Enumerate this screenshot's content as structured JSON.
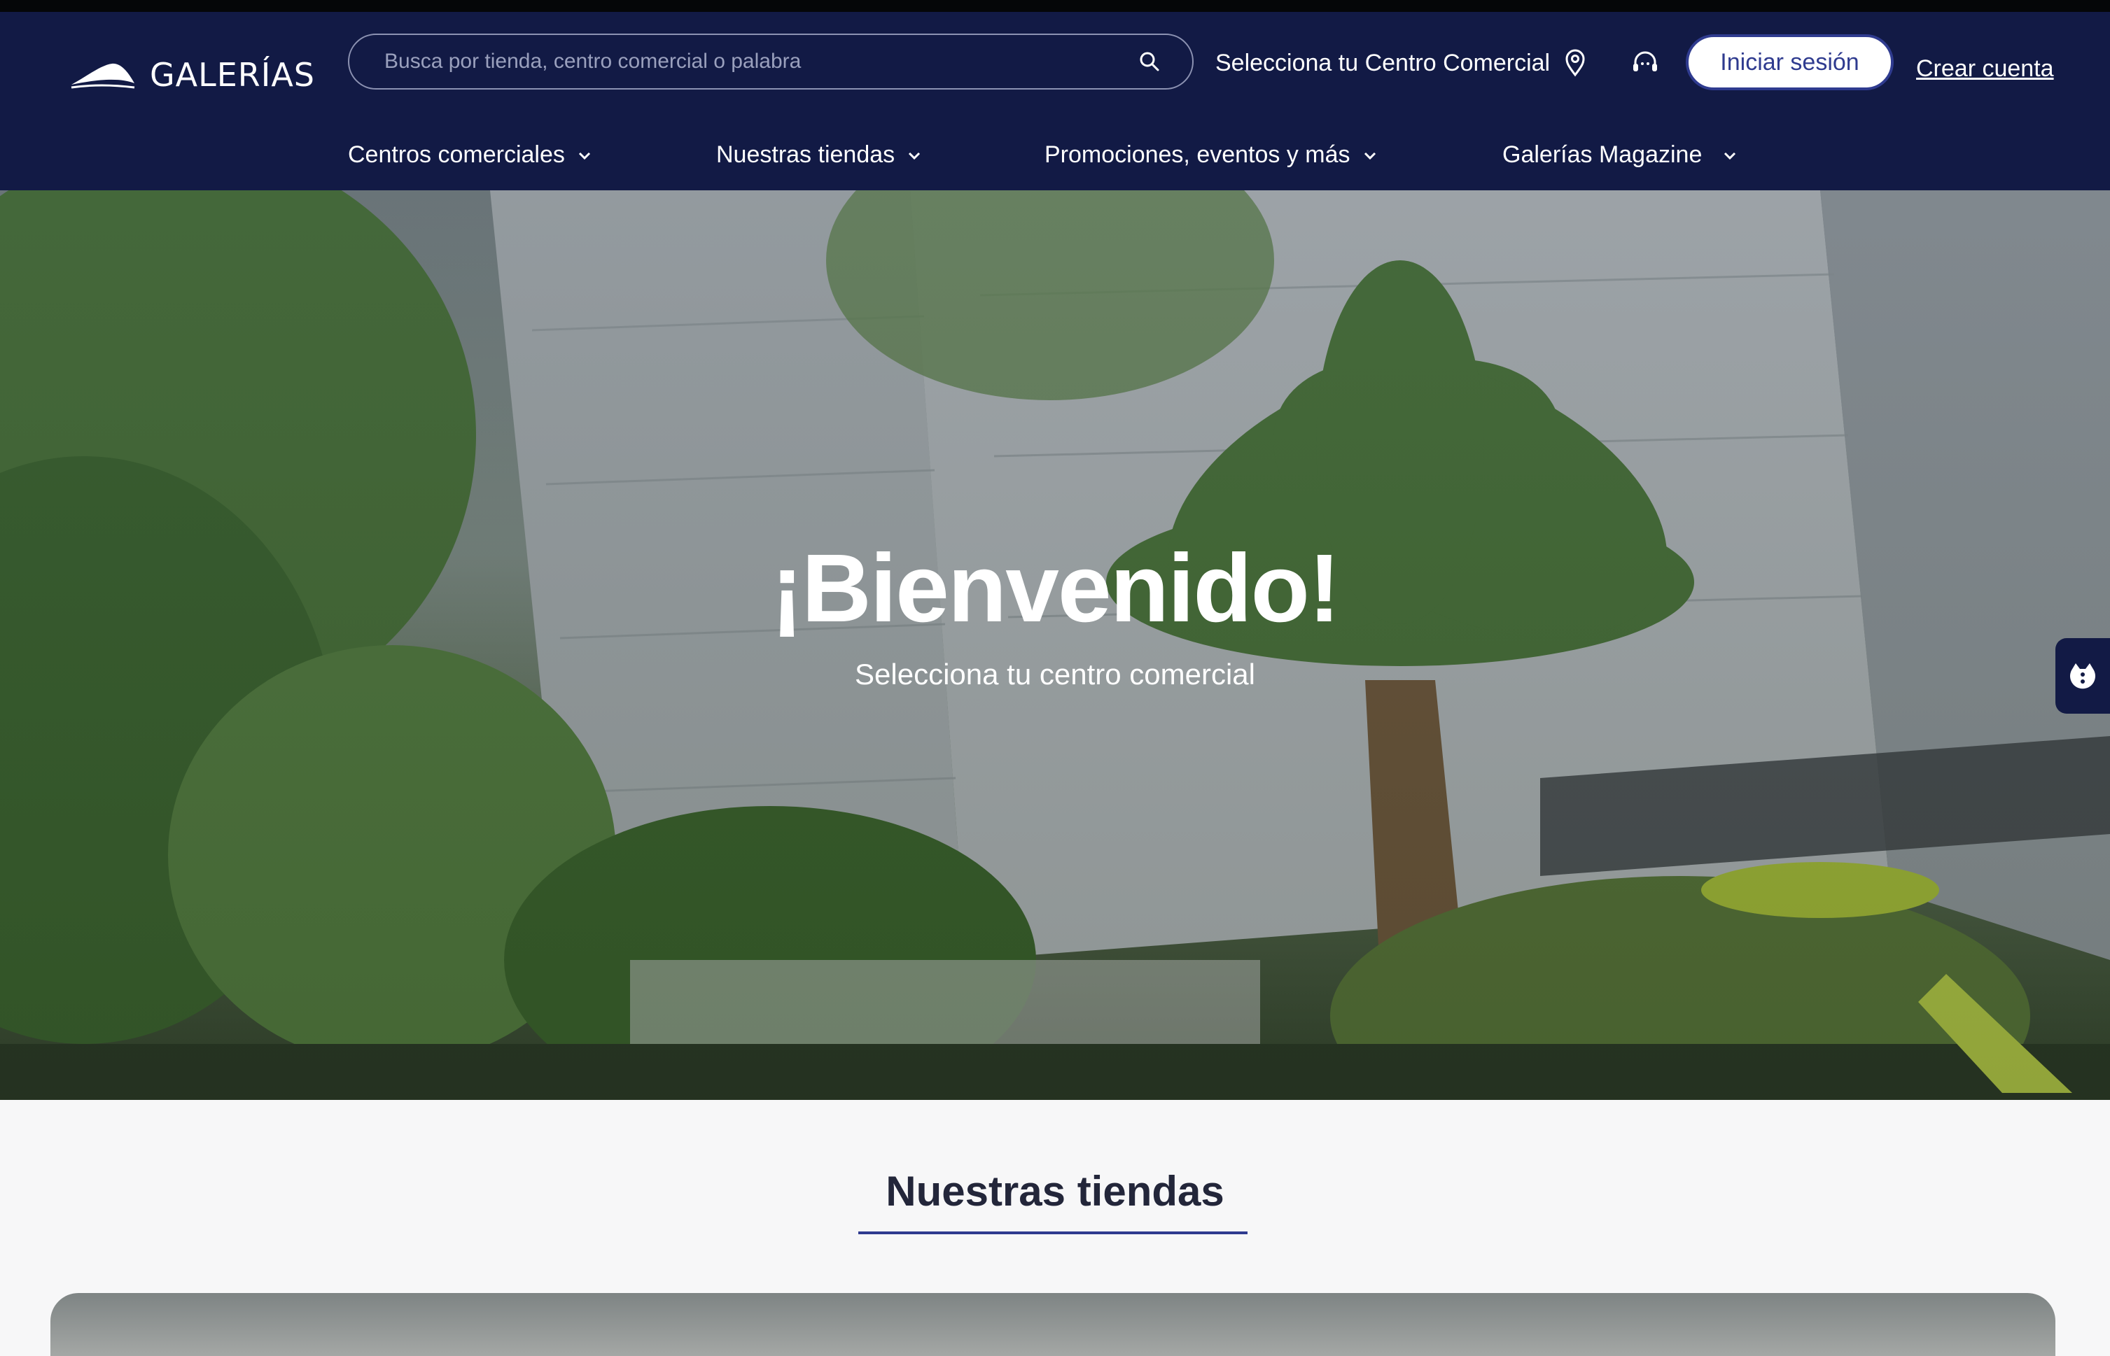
{
  "brand": {
    "name": "GALERÍAS"
  },
  "search": {
    "placeholder": "Busca por tienda, centro comercial o palabra"
  },
  "header": {
    "select_mall": "Selecciona tu Centro Comercial",
    "login": "Iniciar sesión",
    "create_account": "Crear cuenta"
  },
  "nav": {
    "items": [
      {
        "label": "Centros comerciales"
      },
      {
        "label": "Nuestras tiendas"
      },
      {
        "label": "Promociones, eventos y más"
      },
      {
        "label": "Galerías Magazine"
      }
    ]
  },
  "hero": {
    "title": "¡Bienvenido!",
    "subtitle": "Selecciona tu centro comercial"
  },
  "section": {
    "title": "Nuestras tiendas"
  },
  "colors": {
    "header_bg": "#121a45",
    "accent": "#2f3b8f",
    "page_bg": "#f7f7f8"
  },
  "icons": {
    "search": "search-icon",
    "location": "location-pin-icon",
    "support": "headset-icon",
    "chevron": "chevron-down-icon",
    "side_tab": "mascot-icon"
  }
}
